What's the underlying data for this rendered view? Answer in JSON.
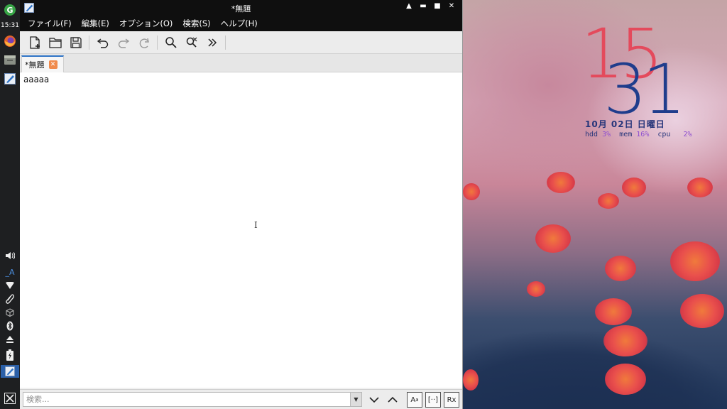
{
  "dock": {
    "clock": "15:31",
    "launcher_icons": [
      "refresh-circle-icon",
      "firefox-icon",
      "file-manager-icon",
      "text-editor-icon"
    ],
    "tray_icons": [
      "volume-icon",
      "input-method-icon",
      "wifi-icon",
      "clip-icon",
      "package-icon",
      "bluetooth-icon",
      "eject-icon",
      "battery-icon",
      "editor-task-icon",
      "menu-x-icon"
    ]
  },
  "window": {
    "title": "*無題",
    "menu": [
      "ファイル(F)",
      "編集(E)",
      "オプション(O)",
      "検索(S)",
      "ヘルプ(H)"
    ],
    "toolbar": [
      "new-file-icon",
      "open-folder-icon",
      "save-icon",
      "undo-icon",
      "redo-icon",
      "redo-all-icon",
      "search-icon",
      "replace-icon",
      "more-icon"
    ],
    "tab_label": "*無題",
    "editor_text": "aaaaa",
    "find_placeholder": "検索..."
  },
  "desktop_clock": {
    "hour": "15",
    "minute": "31",
    "date": "10月 02日 日曜日",
    "stats": [
      {
        "label": "hdd",
        "value": "3%"
      },
      {
        "label": "mem",
        "value": "16%"
      },
      {
        "label": "cpu",
        "value": "2%"
      }
    ]
  },
  "colors": {
    "hour": "#e44a5c",
    "minute": "#1f3d8c",
    "accent": "#2f74c7"
  }
}
